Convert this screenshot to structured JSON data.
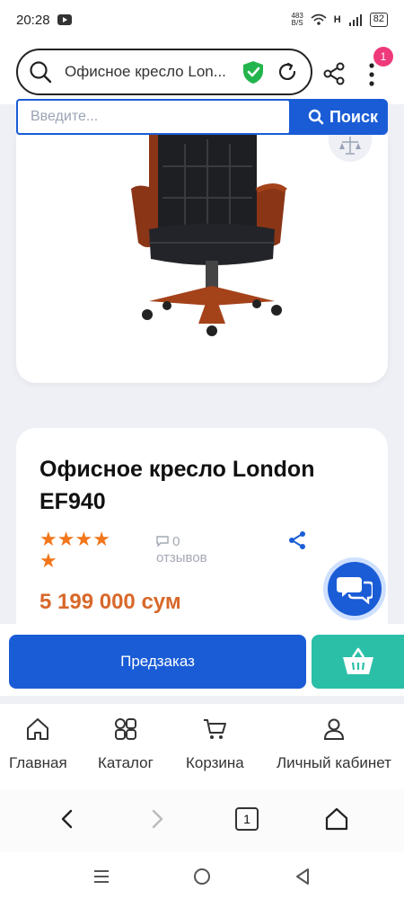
{
  "status_bar": {
    "time": "20:28",
    "speed_top": "483",
    "speed_bottom": "B/S",
    "network": "H",
    "battery": "82"
  },
  "browser": {
    "url_text": "Офисное кресло Lon...",
    "menu_badge": "1",
    "tab_count": "1"
  },
  "site_search": {
    "placeholder": "Введите...",
    "button_label": "Поиск"
  },
  "product": {
    "title": "Офисное кресло London EF940",
    "rating_stars": 5,
    "reviews_count": "0",
    "reviews_label": "отзывов",
    "price": "5 199 000 сум"
  },
  "actions": {
    "preorder_label": "Предзаказ"
  },
  "bottom_nav": {
    "items": [
      {
        "label": "Главная",
        "icon": "home-icon"
      },
      {
        "label": "Каталог",
        "icon": "grid-icon"
      },
      {
        "label": "Корзина",
        "icon": "cart-icon"
      },
      {
        "label": "Личный кабинет",
        "icon": "user-icon"
      }
    ]
  },
  "colors": {
    "primary": "#1a5cd6",
    "accent_teal": "#2bbfa8",
    "price_orange": "#d8682a",
    "star_orange": "#f2761b",
    "badge_pink": "#ee3a7a"
  }
}
